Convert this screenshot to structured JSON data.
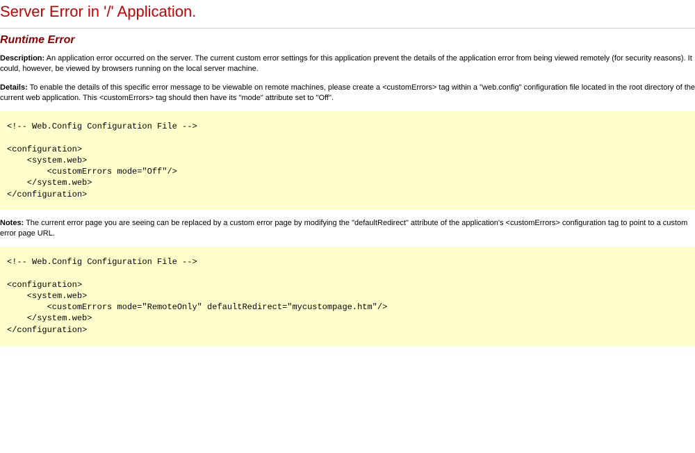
{
  "header": {
    "title": "Server Error in '/' Application.",
    "subtitle": "Runtime Error"
  },
  "description": {
    "label": "Description:",
    "text": " An application error occurred on the server. The current custom error settings for this application prevent the details of the application error from being viewed remotely (for security reasons). It could, however, be viewed by browsers running on the local server machine."
  },
  "details": {
    "label": "Details:",
    "text": " To enable the details of this specific error message to be viewable on remote machines, please create a <customErrors> tag within a \"web.config\" configuration file located in the root directory of the current web application. This <customErrors> tag should then have its \"mode\" attribute set to \"Off\"."
  },
  "codeBlock1": "<!-- Web.Config Configuration File -->\n\n<configuration>\n    <system.web>\n        <customErrors mode=\"Off\"/>\n    </system.web>\n</configuration>",
  "notes": {
    "label": "Notes:",
    "text": " The current error page you are seeing can be replaced by a custom error page by modifying the \"defaultRedirect\" attribute of the application's <customErrors> configuration tag to point to a custom error page URL."
  },
  "codeBlock2": "<!-- Web.Config Configuration File -->\n\n<configuration>\n    <system.web>\n        <customErrors mode=\"RemoteOnly\" defaultRedirect=\"mycustompage.htm\"/>\n    </system.web>\n</configuration>"
}
